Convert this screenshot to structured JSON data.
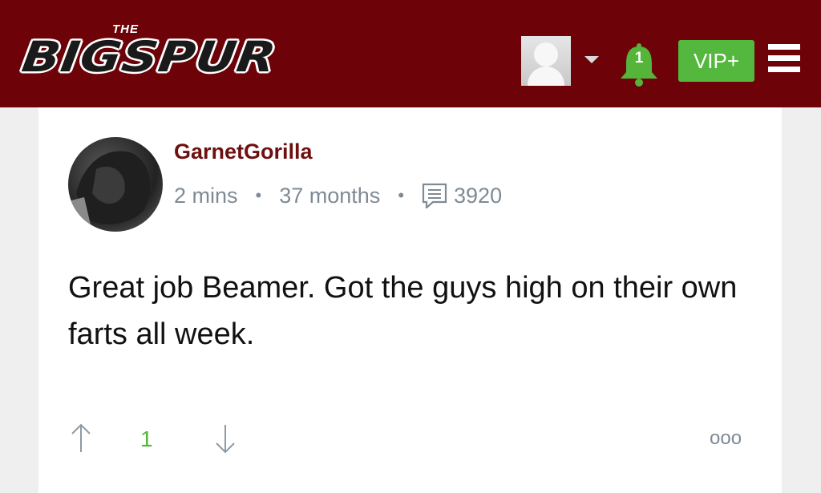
{
  "header": {
    "logo_small": "THE",
    "logo_main": "BIGSPUR",
    "bell_count": "1",
    "vip_label": "VIP+"
  },
  "post": {
    "username": "GarnetGorilla",
    "time_ago": "2 mins",
    "member_age": "37 months",
    "post_count": "3920",
    "body": "Great job Beamer. Got the guys high on their own farts all week.",
    "vote_count": "1",
    "more_label": "ooo"
  },
  "icons": {
    "avatar": "user-silhouette-icon",
    "dropdown": "chevron-down-icon",
    "notifications": "bell-icon",
    "menu": "hamburger-icon",
    "posts": "comment-icon",
    "upvote": "arrow-up-icon",
    "downvote": "arrow-down-icon"
  },
  "colors": {
    "header_bg": "#6e0209",
    "vip_bg": "#53b83d",
    "bell": "#55b43a",
    "username": "#6e1010",
    "meta": "#7f8a94"
  }
}
